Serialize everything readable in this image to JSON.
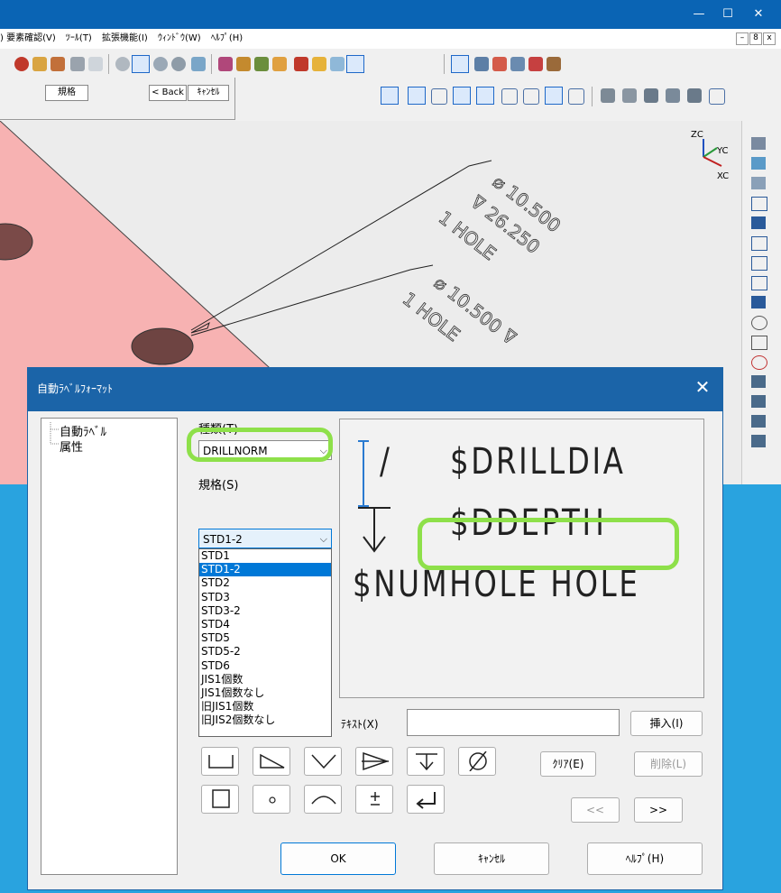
{
  "cad": {
    "menu": [
      ") 要素確認(V)",
      "ﾂｰﾙ(T)",
      "拡張機能(I)",
      "ｳｨﾝﾄﾞｳ(W)",
      "ﾍﾙﾌﾟ(H)"
    ],
    "window_controls": {
      "minimize": "—",
      "maximize": "☐",
      "close": "✕"
    },
    "mdi_controls": [
      "–",
      "8",
      "x"
    ],
    "toolbar2": {
      "standard_btn": "規格",
      "back_btn": "< Back",
      "cancel_btn": "ｷｬﾝｾﾙ"
    },
    "axes": {
      "z": "ZC",
      "y": "YC",
      "x": "XC"
    },
    "annotations": {
      "a1_line1": "⌀ 10.500",
      "a1_line2": "⊽ 26.250",
      "a1_line3": "1 HOLE",
      "a2_line1": "⌀ 10.500 ⊽",
      "a2_line2": "1 HOLE"
    }
  },
  "dialog": {
    "title": "自動ﾗﾍﾞﾙﾌｫｰﾏｯﾄ",
    "close_icon": "✕",
    "tree": [
      "自動ﾗﾍﾞﾙ",
      "属性"
    ],
    "type_label": "種類(T)",
    "type_value": "DRILLNORM",
    "standard_label": "規格(S)",
    "standard_value": "STD1-2",
    "standard_options": [
      "STD1",
      "STD1-2",
      "STD2",
      "STD3",
      "STD3-2",
      "STD4",
      "STD5",
      "STD5-2",
      "STD6",
      "JIS1個数",
      "JIS1個数なし",
      "旧JIS1個数",
      "旧JIS2個数なし"
    ],
    "selected_option_index": 1,
    "preview": {
      "line1_prefix": "/",
      "line1": "$DRILLDIA",
      "line2_symbol": "↓",
      "line2": "$DDEPTH",
      "line3": "$NUMHOLE HOLE"
    },
    "text_label": "ﾃｷｽﾄ(X)",
    "text_value": "",
    "insert_btn": "挿入(I)",
    "clear_btn": "ｸﾘｱ(E)",
    "delete_btn": "削除(L)",
    "prev_btn": "<<",
    "next_btn": ">>",
    "ok_btn": "OK",
    "cancel_btn": "ｷｬﾝｾﾙ",
    "help_btn": "ﾍﾙﾌﾟ(H)",
    "symbols": [
      "counterbore-icon",
      "countersink-triangle-icon",
      "v-groove-icon",
      "arrow-taper-icon",
      "depth-icon",
      "diameter-icon",
      "square-icon",
      "degree-circle-icon",
      "arc-icon",
      "plus-minus-icon",
      "enter-icon"
    ]
  }
}
